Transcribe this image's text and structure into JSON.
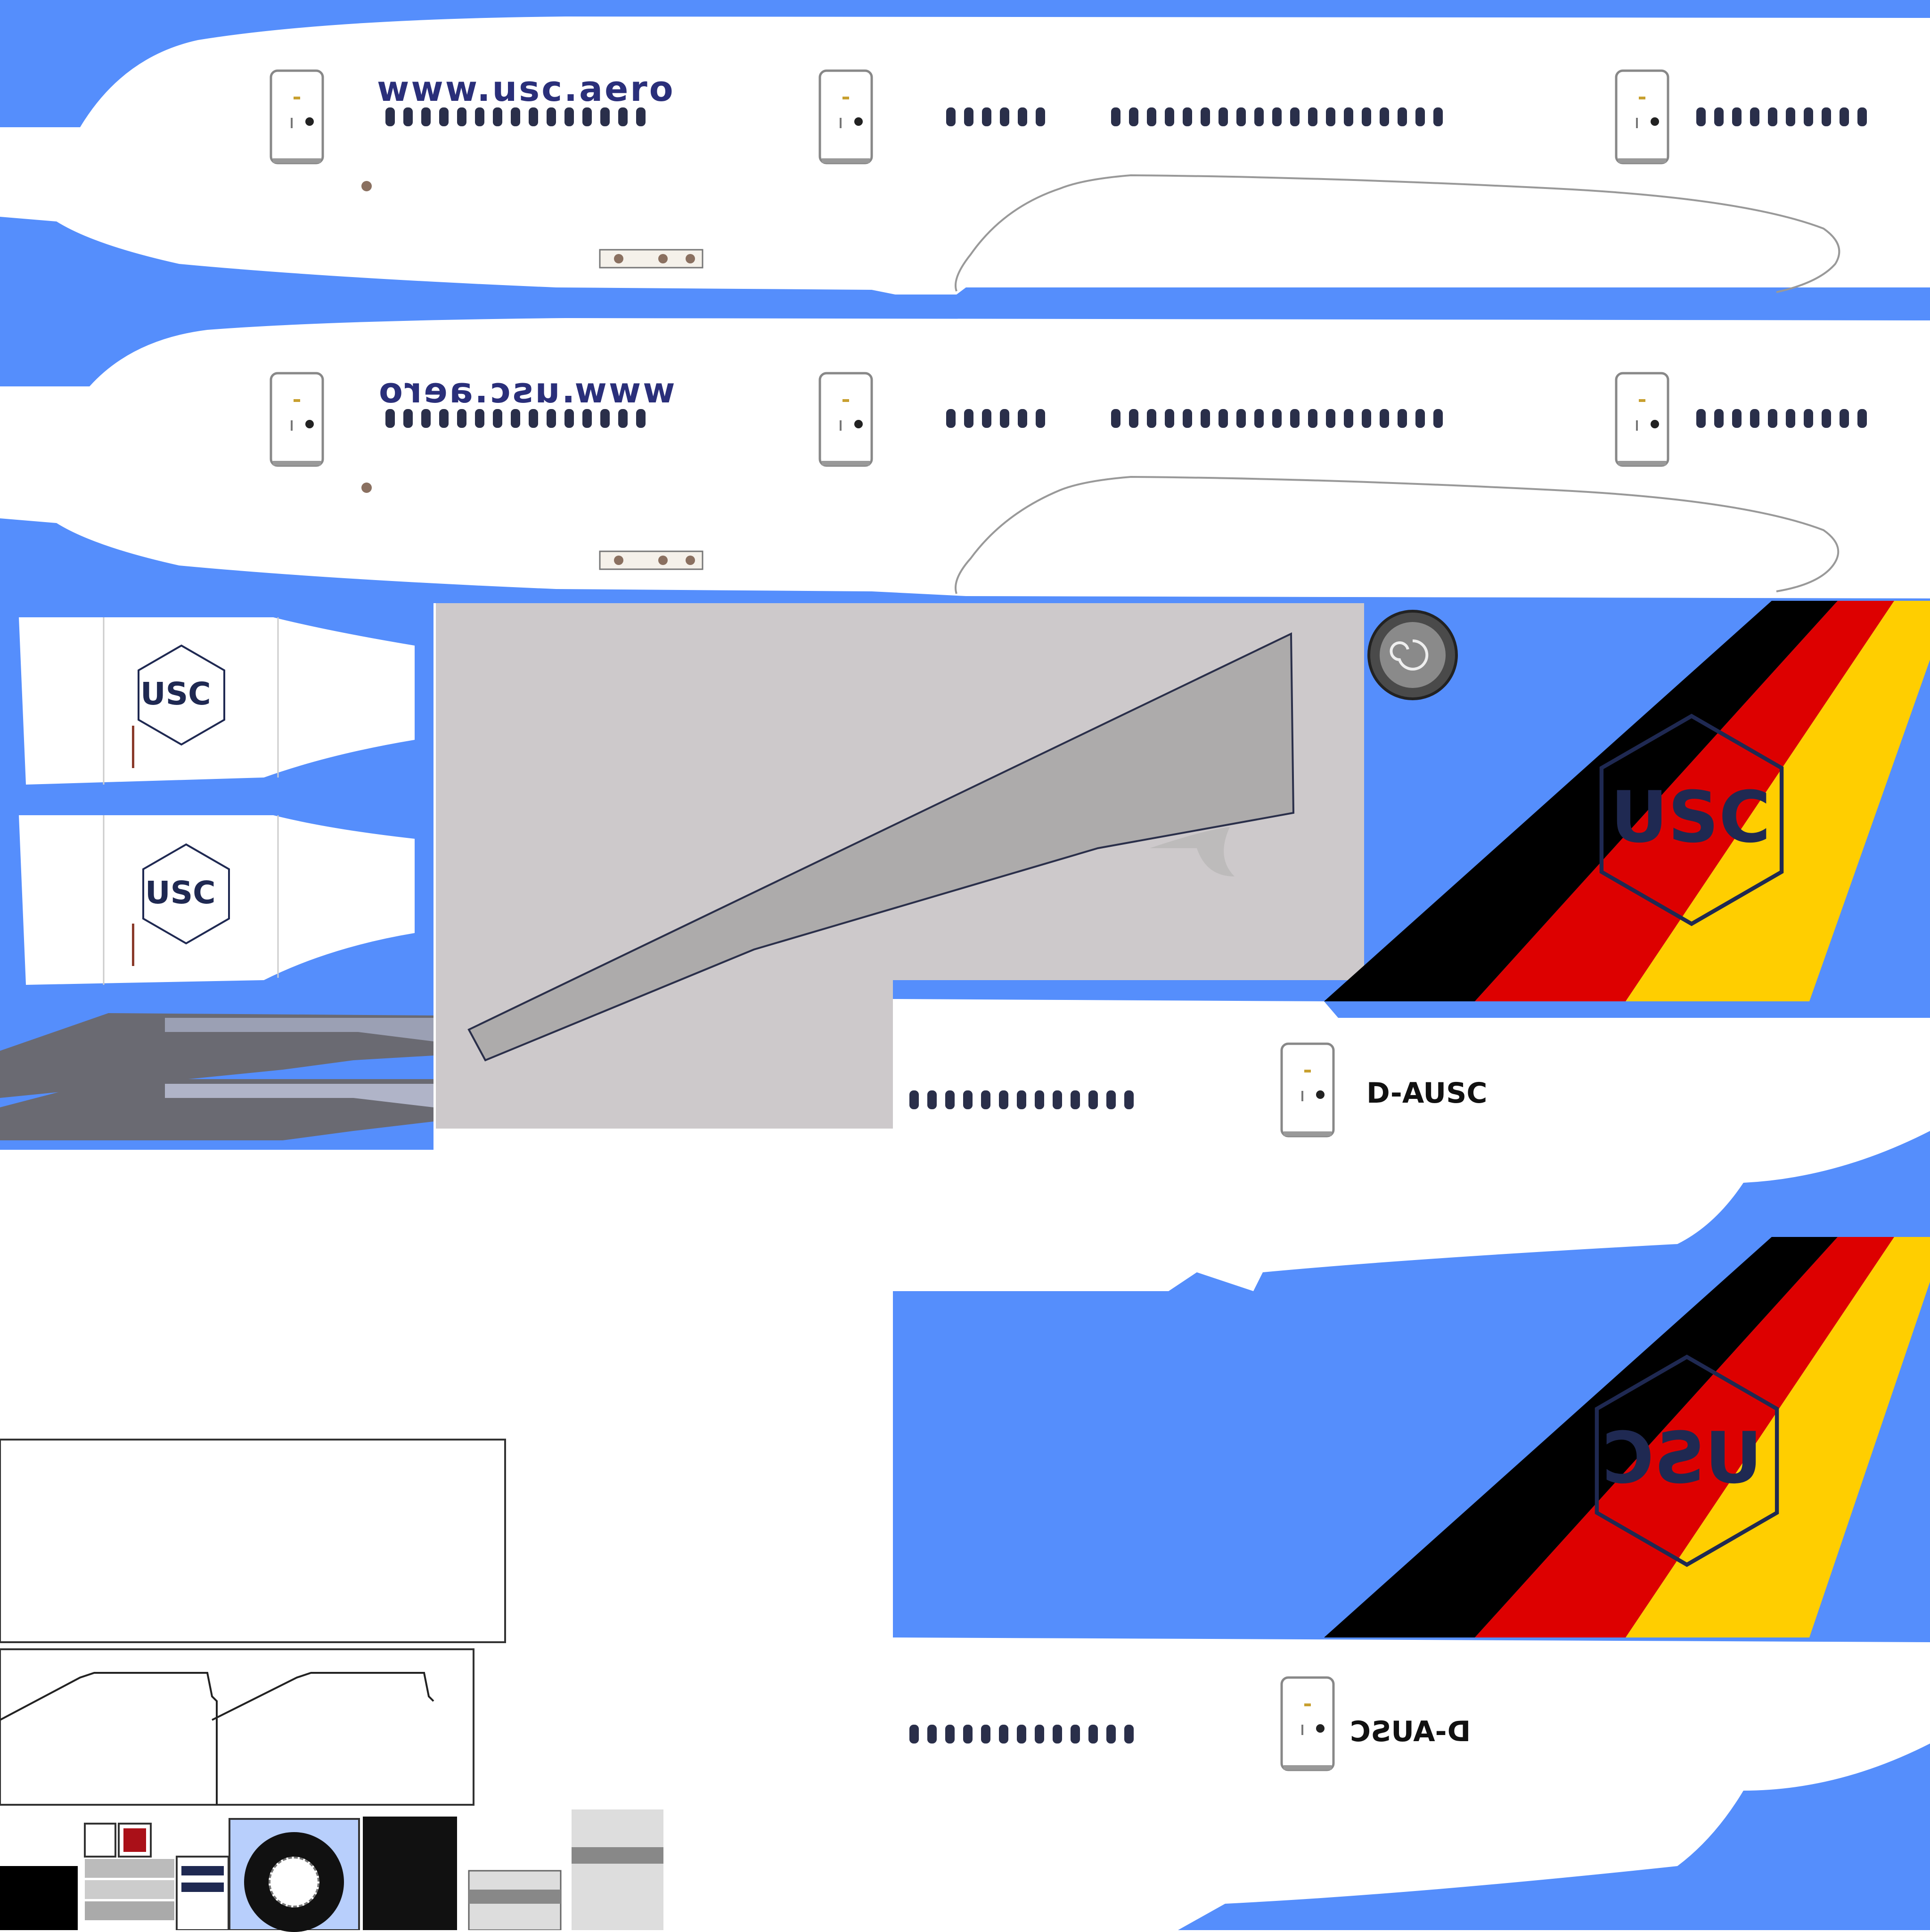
{
  "texture": {
    "background_color": "#558efc",
    "fuselage_color": "#ffffff",
    "flag_colors": [
      "#000000",
      "#dd0000",
      "#ffce00"
    ],
    "window_color": "#2a2f4a",
    "logo_color": "#1f2952",
    "logo_swoosh_color": "#cc1020",
    "wing_panel_color": "#cdc9cb",
    "wing_color": "#adabab",
    "engine_plate_color": "#6a6a72"
  },
  "fuselage_top": {
    "website": "www.usc.aero",
    "window_count_a": 15,
    "window_count_b": 6,
    "window_count_c": 19,
    "window_count_d": 10
  },
  "fuselage_bottom": {
    "website": "www.usc.aero",
    "mirrored": true
  },
  "nacelle_upper": {
    "logo": "USC"
  },
  "nacelle_lower": {
    "logo": "USC"
  },
  "tail_upper": {
    "logo": "USC",
    "registration": "D-AUSC",
    "window_count": 13
  },
  "tail_lower": {
    "logo": "USC",
    "registration": "D-AUSC",
    "window_count": 13,
    "mirrored": true
  },
  "icons": {
    "wheel": "wheel-icon",
    "hub": "spiral-hub-icon",
    "door": "door-icon"
  }
}
